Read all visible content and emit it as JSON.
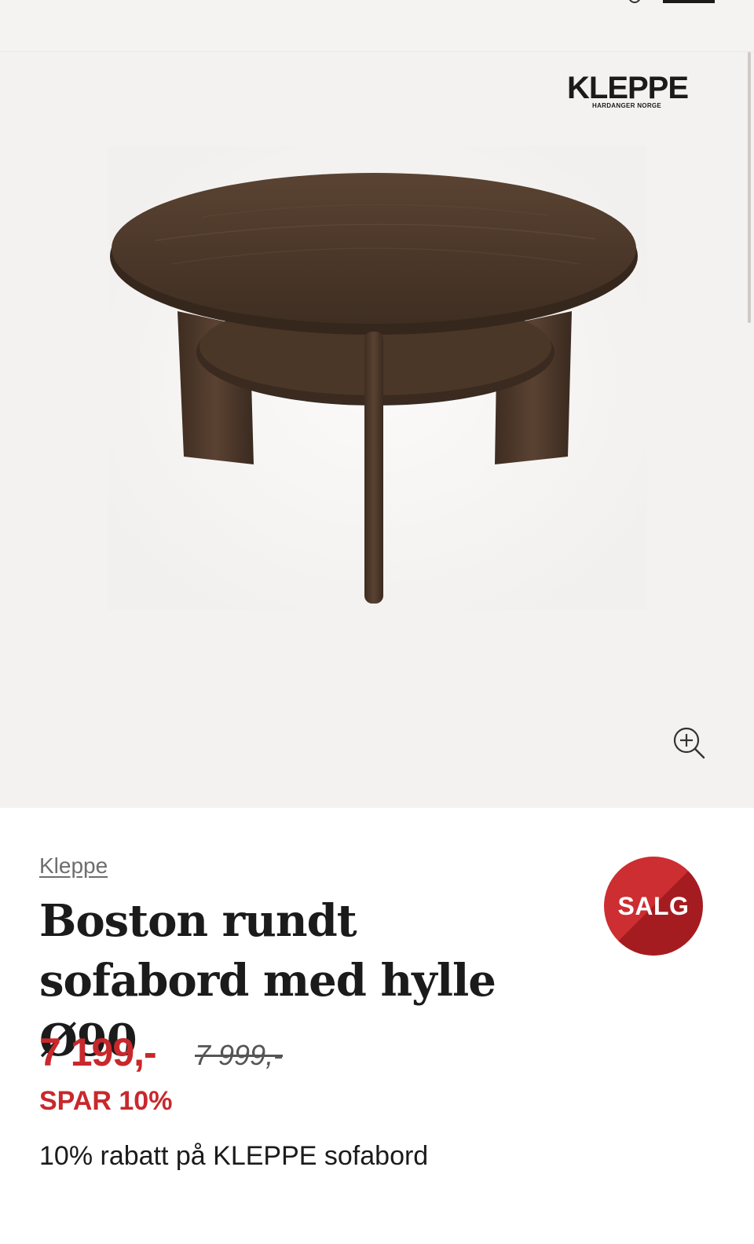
{
  "brand": {
    "logo_text": "KLEPPE",
    "logo_tagline": "HARDANGER NORGE",
    "link_label": "Kleppe"
  },
  "product": {
    "title": "Boston rundt sofabord med hylle Ø90",
    "sale_badge": "SALG",
    "price_current": "7 199,-",
    "price_original": "7 999,-",
    "savings": "SPAR 10%",
    "promo": "10% rabatt på KLEPPE sofabord",
    "image_alt": "Boston rundt sofabord med hylle Ø90"
  },
  "icons": {
    "zoom": "zoom-in-icon"
  },
  "colors": {
    "sale_red": "#c8282c",
    "background_gallery": "#f4f2f0",
    "wood": "#4a3628"
  }
}
